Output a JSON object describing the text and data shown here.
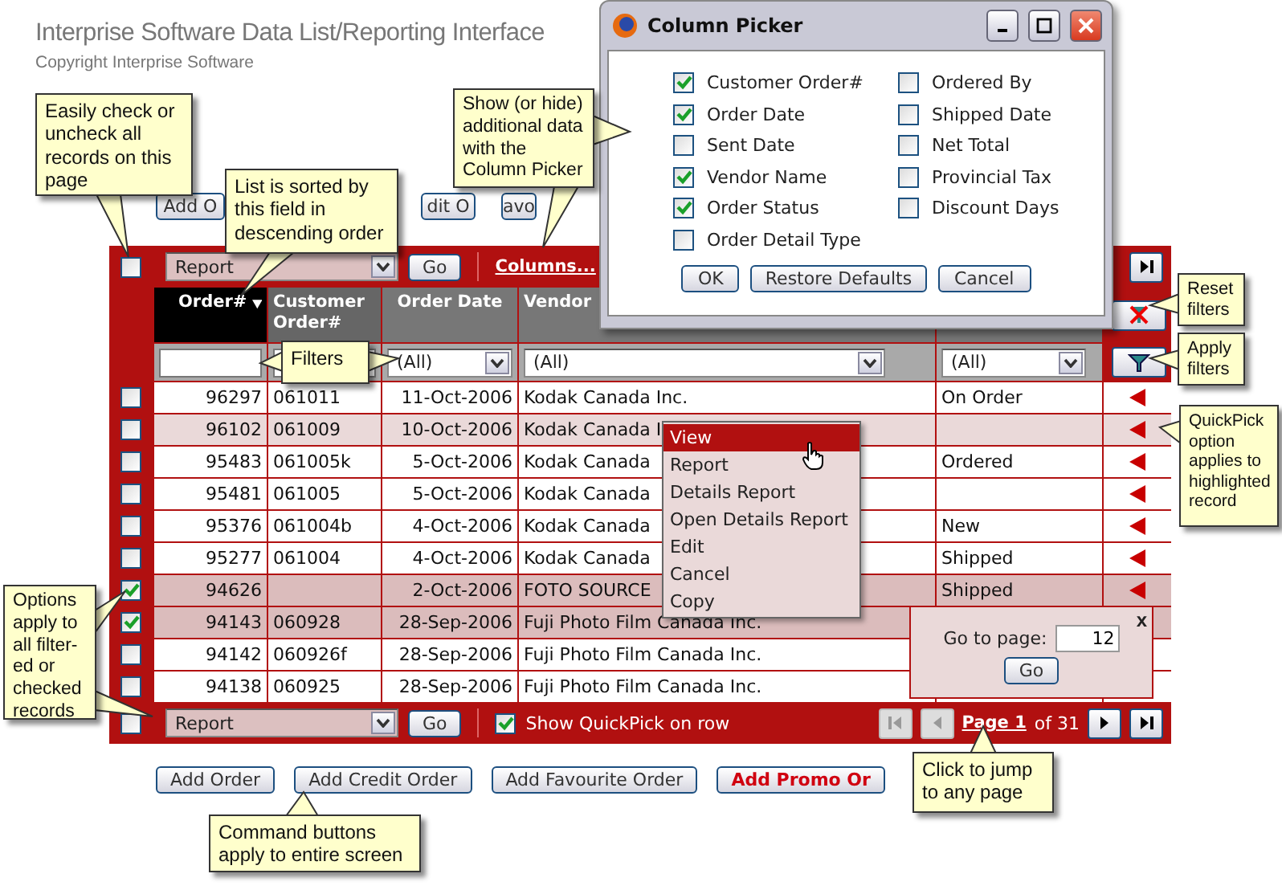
{
  "title": "Interprise Software Data List/Reporting Interface",
  "copyright": "Copyright Interprise Software",
  "top_buttons": [
    "Add O",
    "dit O",
    "avo"
  ],
  "toolbar": {
    "select_all": false,
    "action": "Report",
    "go": "Go",
    "columns_link": "Columns..."
  },
  "columns": [
    {
      "label": "Order#",
      "sorted": true
    },
    {
      "label": "Customer Order#",
      "sorted": false
    },
    {
      "label": "Order Date",
      "sorted": false
    },
    {
      "label": "Vendor",
      "sorted": false
    }
  ],
  "filters": [
    {
      "kind": "text"
    },
    {
      "kind": "text"
    },
    {
      "kind": "select",
      "value": "(All)"
    },
    {
      "kind": "select",
      "value": "(All)"
    },
    {
      "kind": "select",
      "value": "(All)"
    }
  ],
  "rows": [
    {
      "order": "96297",
      "customer": "061011",
      "date": "11-Oct-2006",
      "vendor": "Kodak Canada Inc.",
      "status": "On Order",
      "checked": false,
      "highlighted": false
    },
    {
      "order": "96102",
      "customer": "061009",
      "date": "10-Oct-2006",
      "vendor": "Kodak Canada I",
      "checked": false,
      "highlighted": true
    },
    {
      "order": "95483",
      "customer": "061005k",
      "date": "5-Oct-2006",
      "vendor": "Kodak Canada",
      "status": "Ordered",
      "checked": false,
      "highlighted": false
    },
    {
      "order": "95481",
      "customer": "061005",
      "date": "5-Oct-2006",
      "vendor": "Kodak Canada",
      "checked": false,
      "highlighted": false
    },
    {
      "order": "95376",
      "customer": "061004b",
      "date": "4-Oct-2006",
      "vendor": "Kodak Canada",
      "status": "New",
      "checked": false,
      "highlighted": false
    },
    {
      "order": "95277",
      "customer": "061004",
      "date": "4-Oct-2006",
      "vendor": "Kodak Canada",
      "status": "Shipped",
      "checked": false,
      "highlighted": false
    },
    {
      "order": "94626",
      "date": "2-Oct-2006",
      "vendor": "FOTO SOURCE",
      "status": "Shipped",
      "checked": true,
      "highlighted": false
    },
    {
      "order": "94143",
      "customer": "060928",
      "date": "28-Sep-2006",
      "vendor": "Fuji Photo Film Canada Inc.",
      "checked": true,
      "highlighted": false
    },
    {
      "order": "94142",
      "customer": "060926f",
      "date": "28-Sep-2006",
      "vendor": "Fuji Photo Film Canada Inc.",
      "checked": false,
      "highlighted": false
    },
    {
      "order": "94138",
      "customer": "060925",
      "date": "28-Sep-2006",
      "vendor": "Fuji Photo Film Canada Inc.",
      "checked": false,
      "highlighted": false
    }
  ],
  "footer": {
    "select_all": false,
    "action": "Report",
    "go": "Go",
    "quickpick": {
      "label": "Show QuickPick on row",
      "checked": true
    },
    "pager": {
      "first_disabled": true,
      "prev_disabled": true,
      "next_disabled": false,
      "last_disabled": false,
      "page_link": "Page 1",
      "of_text": "of 31"
    }
  },
  "bottom_buttons": [
    {
      "label": "Add Order",
      "kind": "normal"
    },
    {
      "label": "Add Credit Order",
      "kind": "normal"
    },
    {
      "label": "Add Favourite Order",
      "kind": "normal"
    },
    {
      "label": "Add Promo Or",
      "kind": "promo"
    }
  ],
  "column_picker": {
    "title": "Column Picker",
    "options": [
      {
        "label": "Customer Order#",
        "checked": true
      },
      {
        "label": "Order Date",
        "checked": true
      },
      {
        "label": "Sent Date",
        "checked": false
      },
      {
        "label": "Vendor Name",
        "checked": true
      },
      {
        "label": "Order Status",
        "checked": true
      },
      {
        "label": "Order Detail Type",
        "checked": false
      },
      {
        "label": "Ordered By",
        "checked": false
      },
      {
        "label": "Shipped Date",
        "checked": false
      },
      {
        "label": "Net Total",
        "checked": false
      },
      {
        "label": "Provincial Tax",
        "checked": false
      },
      {
        "label": "Discount Days",
        "checked": false
      }
    ],
    "buttons": [
      "OK",
      "Restore Defaults",
      "Cancel"
    ]
  },
  "context_menu": [
    {
      "label": "View",
      "selected": true
    },
    {
      "label": "Report",
      "selected": false
    },
    {
      "label": "Details Report",
      "selected": false
    },
    {
      "label": "Open Details Report",
      "selected": false
    },
    {
      "label": "Edit",
      "selected": false
    },
    {
      "label": "Cancel",
      "selected": false
    },
    {
      "label": "Copy",
      "selected": false
    }
  ],
  "goto_page": {
    "close": "x",
    "label": "Go to page:",
    "value": "12",
    "button": "Go"
  },
  "callouts": [
    "Easily check or uncheck all records on this page",
    "List is sorted by this field in descending order",
    "Show (or hide) additional data with the Column Picker",
    "Filters",
    "Reset filters",
    "Apply filters",
    "QuickPick option applies to highlighted record",
    "Options apply to all filter-ed or checked records",
    "Command buttons apply to entire screen",
    "Click to jump to any page"
  ]
}
